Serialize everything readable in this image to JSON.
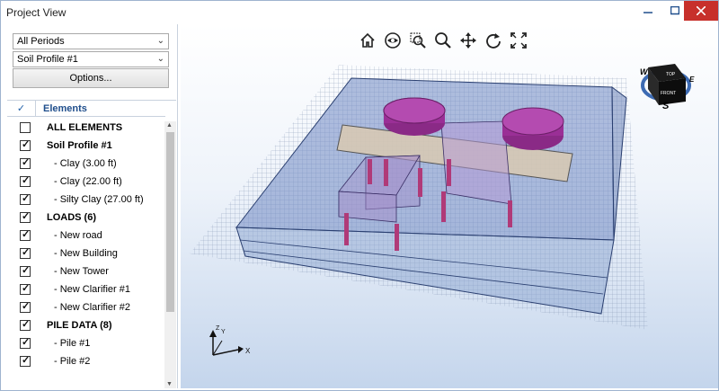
{
  "window": {
    "title": "Project View",
    "controls": [
      "minimize-icon",
      "maximize-icon",
      "close-icon"
    ],
    "close_color": "#c7302b"
  },
  "filters": {
    "period": "All Periods",
    "soil_profile": "Soil Profile #1",
    "options_label": "Options..."
  },
  "grid": {
    "check_header": "✓",
    "elements_header": "Elements",
    "rows": [
      {
        "label": "ALL ELEMENTS",
        "checked": false,
        "bold": true,
        "child": false
      },
      {
        "label": "Soil Profile #1",
        "checked": true,
        "bold": true,
        "child": false
      },
      {
        "label": "- Clay (3.00 ft)",
        "checked": true,
        "bold": false,
        "child": true
      },
      {
        "label": "- Clay (22.00 ft)",
        "checked": true,
        "bold": false,
        "child": true
      },
      {
        "label": "- Silty Clay (27.00 ft)",
        "checked": true,
        "bold": false,
        "child": true
      },
      {
        "label": "LOADS (6)",
        "checked": true,
        "bold": true,
        "child": false
      },
      {
        "label": "- New road",
        "checked": true,
        "bold": false,
        "child": true
      },
      {
        "label": "- New Building",
        "checked": true,
        "bold": false,
        "child": true
      },
      {
        "label": "- New Tower",
        "checked": true,
        "bold": false,
        "child": true
      },
      {
        "label": "- New Clarifier #1",
        "checked": true,
        "bold": false,
        "child": true
      },
      {
        "label": "- New Clarifier #2",
        "checked": true,
        "bold": false,
        "child": true
      },
      {
        "label": "PILE DATA (8)",
        "checked": true,
        "bold": true,
        "child": false
      },
      {
        "label": "- Pile #1",
        "checked": true,
        "bold": false,
        "child": true
      },
      {
        "label": "- Pile #2",
        "checked": true,
        "bold": false,
        "child": true
      }
    ]
  },
  "viewport": {
    "toolbar": [
      "home-icon",
      "view-eye-icon",
      "zoom-window-icon",
      "zoom-icon",
      "pan-icon",
      "rotate-icon",
      "fit-extents-icon"
    ],
    "nav_cube": {
      "top": "TOP",
      "front": "FRONT",
      "west": "W",
      "east": "E",
      "south": "S"
    },
    "axes": {
      "x": "X",
      "y": "Y",
      "z": "Z"
    },
    "colors": {
      "soil": "#8aa3cf",
      "clarifier": "#b03aa8",
      "road": "#c9bca8",
      "pile": "#b03a78"
    }
  }
}
